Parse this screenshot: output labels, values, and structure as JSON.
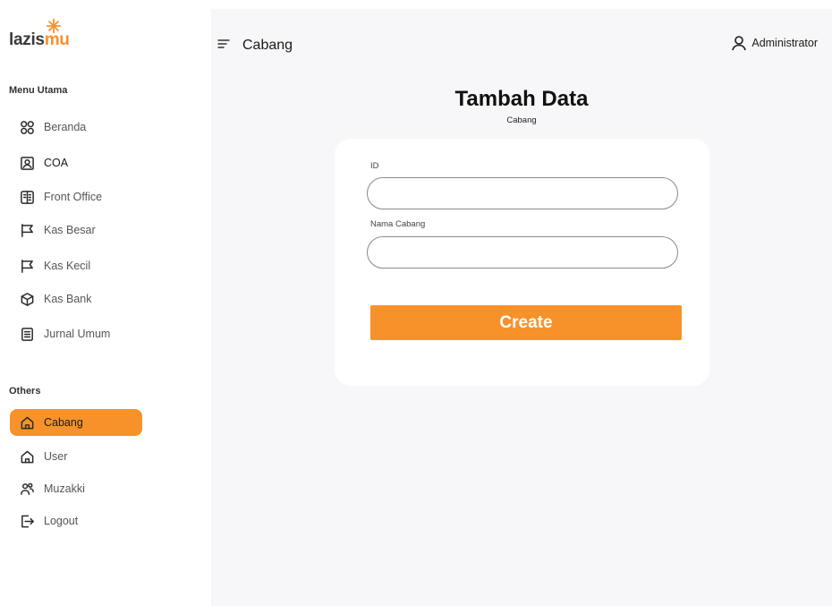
{
  "brand": {
    "logo_main": "lazis",
    "logo_accent": "mu",
    "accent_color": "#f7922a"
  },
  "sidebar": {
    "section_main": "Menu Utama",
    "main_items": [
      {
        "label": "Beranda",
        "icon": "grid-icon"
      },
      {
        "label": "COA",
        "icon": "contact-icon"
      },
      {
        "label": "Front Office",
        "icon": "building-icon"
      },
      {
        "label": "Kas Besar",
        "icon": "flag-icon"
      },
      {
        "label": "Kas Kecil",
        "icon": "flag-icon"
      },
      {
        "label": "Kas Bank",
        "icon": "box-icon"
      },
      {
        "label": "Jurnal Umum",
        "icon": "document-icon"
      }
    ],
    "section_others": "Others",
    "other_items": [
      {
        "label": "Cabang",
        "icon": "home-icon",
        "active": true
      },
      {
        "label": "User",
        "icon": "home-icon"
      },
      {
        "label": "Muzakki",
        "icon": "users-icon"
      },
      {
        "label": "Logout",
        "icon": "logout-icon"
      }
    ]
  },
  "header": {
    "title": "Cabang",
    "user_name": "Administrator"
  },
  "page": {
    "title": "Tambah Data",
    "subtitle": "Cabang"
  },
  "form": {
    "id_label": "ID",
    "id_value": "",
    "name_label": "Nama Cabang",
    "name_value": "",
    "submit_label": "Create"
  }
}
